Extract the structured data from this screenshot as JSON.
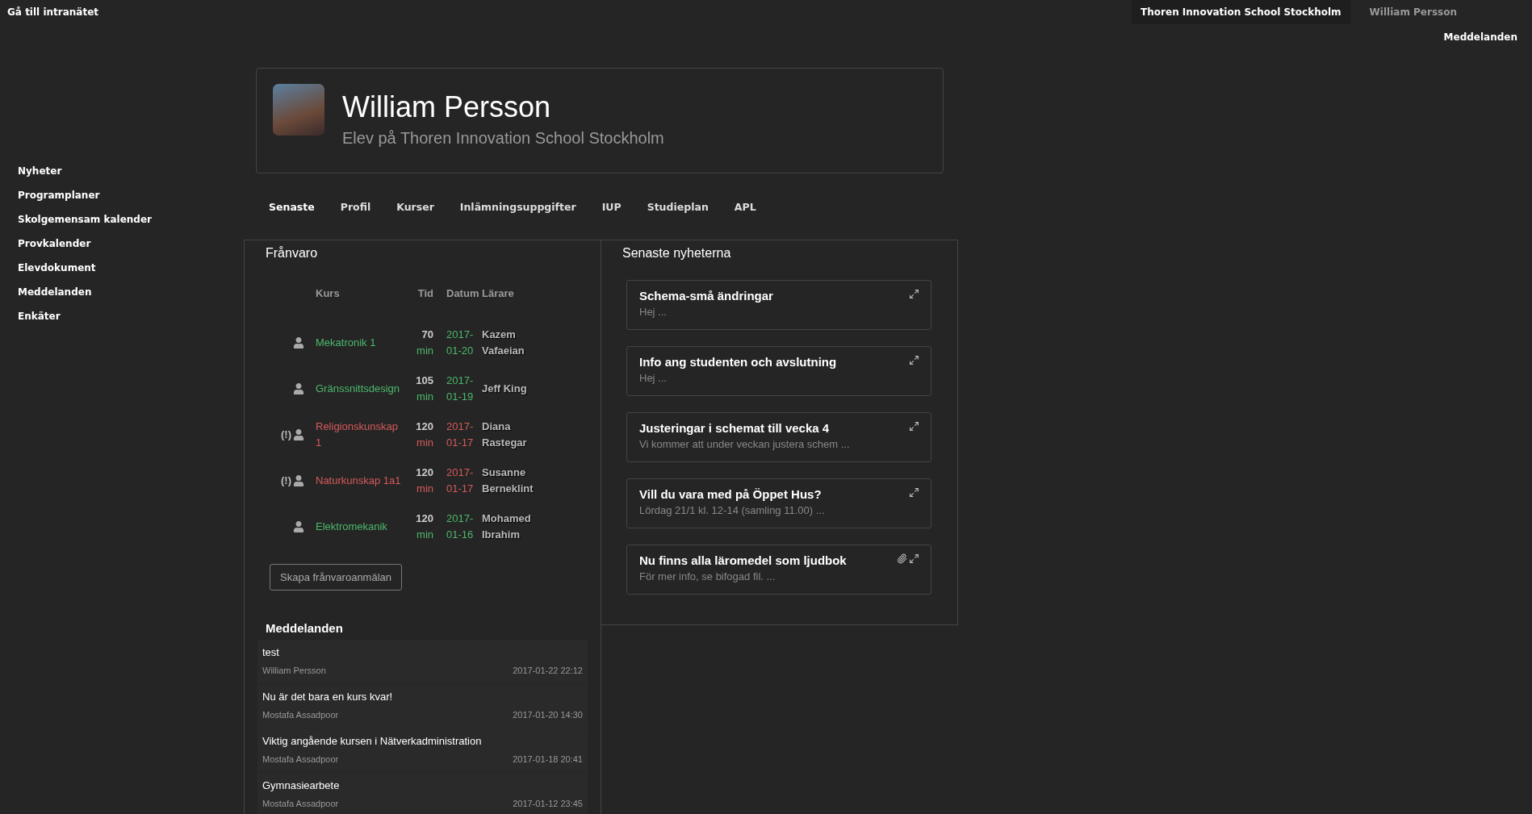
{
  "top_bar": {
    "intranet_link": "Gå till intranätet",
    "school": "Thoren Innovation School Stockholm",
    "user": "William Persson",
    "messages_link": "Meddelanden"
  },
  "sidebar": {
    "items": [
      "Nyheter",
      "Programplaner",
      "Skolgemensam kalender",
      "Provkalender",
      "Elevdokument",
      "Meddelanden",
      "Enkäter"
    ]
  },
  "profile": {
    "name": "William Persson",
    "subtitle": "Elev på Thoren Innovation School Stockholm"
  },
  "tabs": [
    {
      "label": "Senaste",
      "selected": true
    },
    {
      "label": "Profil",
      "selected": false
    },
    {
      "label": "Kurser",
      "selected": false
    },
    {
      "label": "Inlämningsuppgifter",
      "selected": false
    },
    {
      "label": "IUP",
      "selected": false
    },
    {
      "label": "Studieplan",
      "selected": false
    },
    {
      "label": "APL",
      "selected": false
    }
  ],
  "absence": {
    "title": "Frånvaro",
    "columns": [
      "Kurs",
      "Tid",
      "Datum",
      "Lärare"
    ],
    "rows": [
      {
        "flagged": false,
        "course": "Mekatronik 1",
        "minutes": "70",
        "unit": "min",
        "date": "2017-01-20",
        "teacher": "Kazem Vafaeian"
      },
      {
        "flagged": false,
        "course": "Gränssnittsdesign",
        "minutes": "105",
        "unit": "min",
        "date": "2017-01-19",
        "teacher": "Jeff King"
      },
      {
        "flagged": true,
        "flag": "(!)",
        "course": "Religionskunskap 1",
        "minutes": "120",
        "unit": "min",
        "date": "2017-01-17",
        "teacher": "Diana Rastegar"
      },
      {
        "flagged": true,
        "flag": "(!)",
        "course": "Naturkunskap 1a1",
        "minutes": "120",
        "unit": "min",
        "date": "2017-01-17",
        "teacher": "Susanne Berneklint"
      },
      {
        "flagged": false,
        "course": "Elektromekanik",
        "minutes": "120",
        "unit": "min",
        "date": "2017-01-16",
        "teacher": "Mohamed Ibrahim"
      }
    ],
    "button": "Skapa frånvaroanmälan"
  },
  "messages": {
    "title": "Meddelanden",
    "items": [
      {
        "subject": "test",
        "author": "William Persson",
        "time": "2017-01-22 22:12"
      },
      {
        "subject": "Nu är det bara en kurs kvar!",
        "author": "Mostafa Assadpoor",
        "time": "2017-01-20 14:30"
      },
      {
        "subject": "Viktig angående kursen i Nätverkadministration",
        "author": "Mostafa Assadpoor",
        "time": "2017-01-18 20:41"
      },
      {
        "subject": "Gymnasiearbete",
        "author": "Mostafa Assadpoor",
        "time": "2017-01-12 23:45"
      }
    ]
  },
  "news": {
    "title": "Senaste nyheterna",
    "items": [
      {
        "title": "Schema-små ändringar",
        "excerpt": "Hej ...",
        "attachment": false
      },
      {
        "title": "Info ang studenten och avslutning",
        "excerpt": "Hej ...",
        "attachment": false
      },
      {
        "title": "Justeringar i schemat till vecka 4",
        "excerpt": "Vi kommer att under veckan justera schem ...",
        "attachment": false
      },
      {
        "title": "Vill du vara med på Öppet Hus?",
        "excerpt": "Lördag 21/1 kl. 12-14 (samling 11.00) ...",
        "attachment": false
      },
      {
        "title": "Nu finns alla läromedel som ljudbok",
        "excerpt": "För mer info, se bifogad fil. ...",
        "attachment": true
      }
    ]
  }
}
